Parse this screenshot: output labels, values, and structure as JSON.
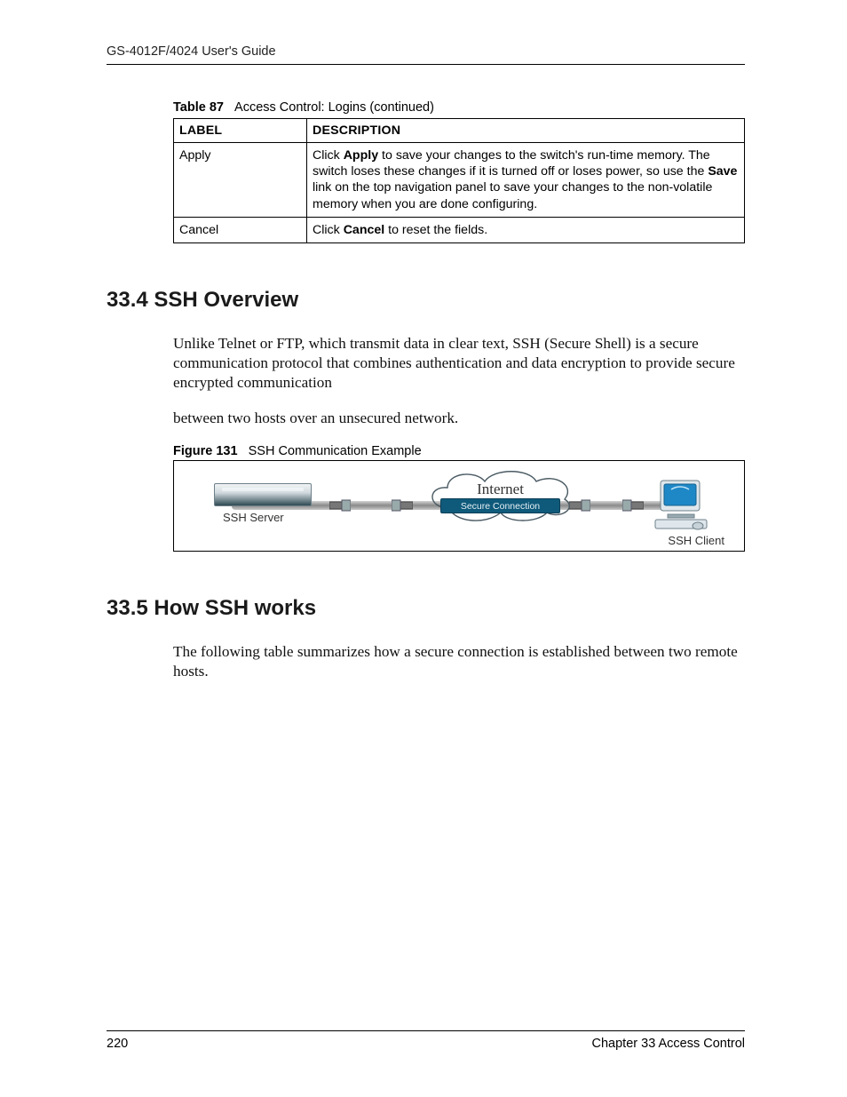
{
  "header": {
    "guide_title": "GS-4012F/4024 User's Guide"
  },
  "table87": {
    "caption_label": "Table 87",
    "caption_text": "Access Control: Logins  (continued)",
    "head": {
      "c1": "LABEL",
      "c2": "DESCRIPTION"
    },
    "rows": [
      {
        "label": "Apply",
        "desc_pre": "Click ",
        "desc_b1": "Apply",
        "desc_mid": " to save your changes to the switch's run-time memory. The switch loses these changes if it is turned off or loses power, so use the ",
        "desc_b2": "Save",
        "desc_post": " link on the top navigation panel to save your changes to the non-volatile memory when you are done configuring."
      },
      {
        "label": "Cancel",
        "desc_pre": "Click ",
        "desc_b1": "Cancel",
        "desc_mid": " to reset the fields.",
        "desc_b2": "",
        "desc_post": ""
      }
    ]
  },
  "sect_334": {
    "heading": "33.4  SSH Overview",
    "p1": "Unlike Telnet or FTP, which transmit data in clear text, SSH (Secure Shell) is a secure communication protocol that combines authentication and data encryption to provide secure encrypted communication",
    "p2": "between two hosts over an unsecured network."
  },
  "fig131": {
    "caption_label": "Figure 131",
    "caption_text": "SSH Communication Example",
    "cloud_label": "Internet",
    "secure_label": "Secure Connection",
    "server_label": "SSH Server",
    "client_label": "SSH Client"
  },
  "sect_335": {
    "heading": "33.5  How SSH works",
    "p1": "The following table summarizes how a secure connection is established between two remote hosts."
  },
  "footer": {
    "page": "220",
    "chapter": "Chapter 33 Access Control"
  }
}
